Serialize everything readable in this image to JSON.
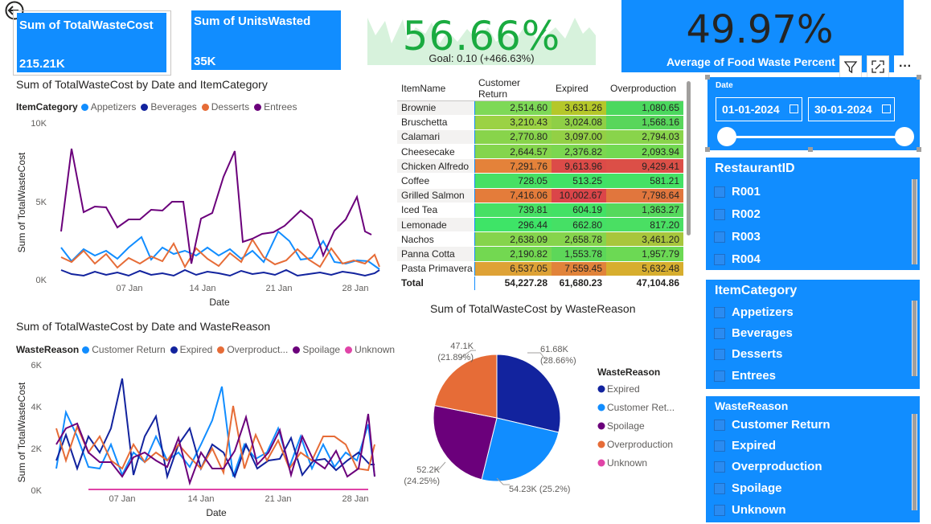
{
  "cards": {
    "total_waste_cost": {
      "label": "Sum of TotalWasteCost",
      "value": "215.21K"
    },
    "units_wasted": {
      "label": "Sum of UnitsWasted",
      "value": "35K"
    }
  },
  "kpi": {
    "value": "56.66%",
    "goal_text": "Goal: 0.10 (+466.63%)",
    "status_color": "#1aab40"
  },
  "avg_waste": {
    "value": "49.97%",
    "label": "Average of Food Waste Percent"
  },
  "visual_header": {
    "filter_icon": "filter-icon",
    "focus_icon": "focus-mode-icon",
    "more_icon": "more-options-icon",
    "more_label": "···"
  },
  "colors": {
    "accent": "#118dff",
    "appetizers": "#118dff",
    "beverages": "#12239e",
    "desserts": "#e66c37",
    "entrees": "#6b007b",
    "unknown": "#e044a7"
  },
  "line_chart_1": {
    "title": "Sum of TotalWasteCost by Date and ItemCategory",
    "legend_title": "ItemCategory",
    "legend": [
      "Appetizers",
      "Beverages",
      "Desserts",
      "Entrees"
    ],
    "y_ticks": [
      "10K",
      "5K",
      "0K"
    ],
    "x_ticks": [
      "07 Jan",
      "14 Jan",
      "21 Jan",
      "28 Jan"
    ],
    "ylabel": "Sum of TotalWasteCost",
    "xlabel": "Date"
  },
  "line_chart_2": {
    "title": "Sum of TotalWasteCost by Date and WasteReason",
    "legend_title": "WasteReason",
    "legend": [
      "Customer Return",
      "Expired",
      "Overproduct...",
      "Spoilage",
      "Unknown"
    ],
    "y_ticks": [
      "6K",
      "4K",
      "2K",
      "0K"
    ],
    "x_ticks": [
      "07 Jan",
      "14 Jan",
      "21 Jan",
      "28 Jan"
    ],
    "ylabel": "Sum of TotalWasteCost",
    "xlabel": "Date"
  },
  "matrix": {
    "headers": [
      "ItemName",
      "Customer Return",
      "Expired",
      "Overproduction"
    ],
    "rows": [
      {
        "name": "Brownie",
        "cr": "2,514.60",
        "ex": "3,631.26",
        "ov": "1,080.65"
      },
      {
        "name": "Bruschetta",
        "cr": "3,210.43",
        "ex": "3,024.08",
        "ov": "1,568.16"
      },
      {
        "name": "Calamari",
        "cr": "2,770.80",
        "ex": "3,097.00",
        "ov": "2,794.03"
      },
      {
        "name": "Cheesecake",
        "cr": "2,644.57",
        "ex": "2,376.82",
        "ov": "2,093.94"
      },
      {
        "name": "Chicken Alfredo",
        "cr": "7,291.76",
        "ex": "9,613.96",
        "ov": "9,429.41"
      },
      {
        "name": "Coffee",
        "cr": "728.05",
        "ex": "513.25",
        "ov": "581.21"
      },
      {
        "name": "Grilled Salmon",
        "cr": "7,416.06",
        "ex": "10,002.67",
        "ov": "7,798.64"
      },
      {
        "name": "Iced Tea",
        "cr": "739.81",
        "ex": "604.19",
        "ov": "1,363.27"
      },
      {
        "name": "Lemonade",
        "cr": "296.44",
        "ex": "662.80",
        "ov": "817.20"
      },
      {
        "name": "Nachos",
        "cr": "2,638.09",
        "ex": "2,658.78",
        "ov": "3,461.20"
      },
      {
        "name": "Panna Cotta",
        "cr": "2,190.82",
        "ex": "1,553.78",
        "ov": "1,957.79"
      },
      {
        "name": "Pasta Primavera",
        "cr": "6,537.05",
        "ex": "7,559.45",
        "ov": "5,632.48"
      }
    ],
    "total": {
      "name": "Total",
      "cr": "54,227.28",
      "ex": "61,680.23",
      "ov": "47,104.86"
    }
  },
  "pie": {
    "title": "Sum of TotalWasteCost by WasteReason",
    "legend_title": "WasteReason",
    "legend": [
      "Expired",
      "Customer Ret...",
      "Spoilage",
      "Overproduction",
      "Unknown"
    ],
    "labels": {
      "expired": [
        "61.68K",
        "(28.66%)"
      ],
      "customer_return": [
        "54.23K (25.2%)"
      ],
      "spoilage": [
        "52.2K",
        "(24.25%)"
      ],
      "overproduction": [
        "47.1K",
        "(21.89%)"
      ]
    }
  },
  "chart_data": {
    "type": "pie",
    "title": "Sum of TotalWasteCost by WasteReason",
    "categories": [
      "Expired",
      "Customer Return",
      "Spoilage",
      "Overproduction",
      "Unknown"
    ],
    "values": [
      61.68,
      54.23,
      52.2,
      47.1,
      0
    ],
    "percent": [
      28.66,
      25.2,
      24.25,
      21.89,
      0
    ],
    "colors": [
      "#12239e",
      "#118dff",
      "#6b007b",
      "#e66c37",
      "#e044a7"
    ]
  },
  "date_slicer": {
    "title": "Date",
    "start": "01-01-2024",
    "end": "30-01-2024"
  },
  "slicer_restaurant": {
    "title": "RestaurantID",
    "options": [
      "R001",
      "R002",
      "R003",
      "R004"
    ]
  },
  "slicer_category": {
    "title": "ItemCategory",
    "options": [
      "Appetizers",
      "Beverages",
      "Desserts",
      "Entrees"
    ]
  },
  "slicer_reason": {
    "title": "WasteReason",
    "options": [
      "Customer Return",
      "Expired",
      "Overproduction",
      "Spoilage",
      "Unknown"
    ]
  }
}
